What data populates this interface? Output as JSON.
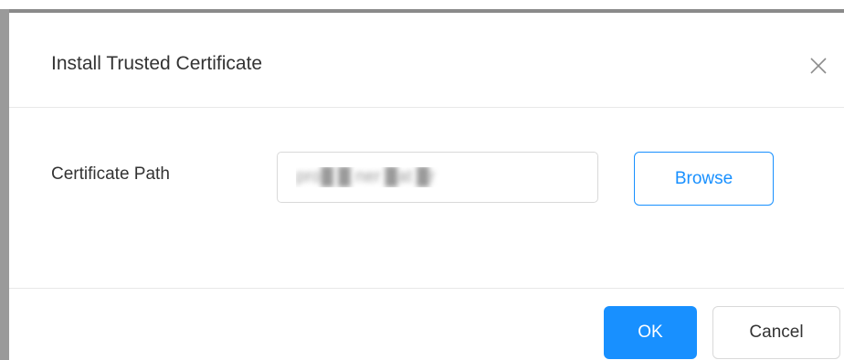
{
  "dialog": {
    "title": "Install Trusted Certificate",
    "close_icon": "close-icon"
  },
  "form": {
    "certificate_path_label": "Certificate Path",
    "certificate_path_value": "pro█ █ ner █at █r",
    "browse_label": "Browse"
  },
  "footer": {
    "ok_label": "OK",
    "cancel_label": "Cancel"
  },
  "colors": {
    "accent": "#1890ff",
    "text": "#333333",
    "border": "#d9d9d9",
    "divider": "#e8e8e8"
  }
}
